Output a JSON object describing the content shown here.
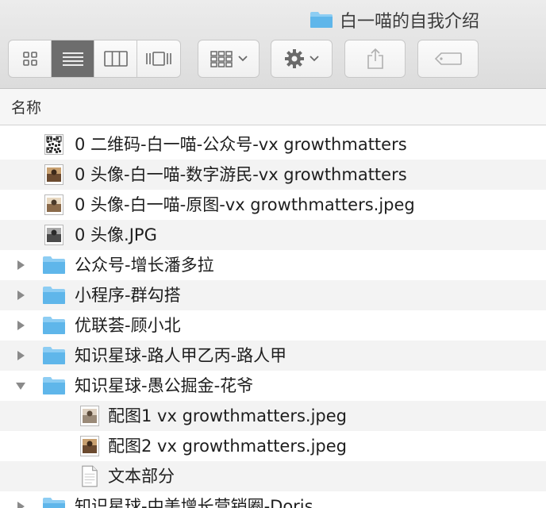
{
  "window": {
    "title": "白一喵的自我介绍"
  },
  "toolbar": {
    "view_buttons": [
      {
        "name": "icon-view",
        "active": false
      },
      {
        "name": "list-view",
        "active": true
      },
      {
        "name": "column-view",
        "active": false
      },
      {
        "name": "gallery-view",
        "active": false
      }
    ]
  },
  "column_header": {
    "name_label": "名称"
  },
  "files": [
    {
      "label": "0 二维码-白一喵-公众号-vx growthmatters",
      "kind": "qr-thumb",
      "level": 0,
      "expanded": null
    },
    {
      "label": "0 头像-白一喵-数字游民-vx growthmatters",
      "kind": "photo-thumb",
      "level": 0,
      "expanded": null
    },
    {
      "label": "0 头像-白一喵-原图-vx growthmatters.jpeg",
      "kind": "photo-thumb",
      "level": 0,
      "expanded": null
    },
    {
      "label": "0 头像.JPG",
      "kind": "photo-thumb",
      "level": 0,
      "expanded": null
    },
    {
      "label": "公众号-增长潘多拉",
      "kind": "folder",
      "level": 0,
      "expanded": false
    },
    {
      "label": "小程序-群勾搭",
      "kind": "folder",
      "level": 0,
      "expanded": false
    },
    {
      "label": "优联荟-顾小北",
      "kind": "folder",
      "level": 0,
      "expanded": false
    },
    {
      "label": "知识星球-路人甲乙丙-路人甲",
      "kind": "folder",
      "level": 0,
      "expanded": false
    },
    {
      "label": "知识星球-愚公掘金-花爷",
      "kind": "folder",
      "level": 0,
      "expanded": true
    },
    {
      "label": "配图1 vx growthmatters.jpeg",
      "kind": "photo-thumb",
      "level": 1,
      "expanded": null
    },
    {
      "label": "配图2 vx growthmatters.jpeg",
      "kind": "photo-thumb",
      "level": 1,
      "expanded": null
    },
    {
      "label": "文本部分",
      "kind": "document",
      "level": 1,
      "expanded": null
    },
    {
      "label": "知识星球-中美增长营销圈-Doris",
      "kind": "folder",
      "level": 0,
      "expanded": false
    }
  ],
  "colors": {
    "folder": "#5fb6ea",
    "folder_tab": "#8dcdf3",
    "active_view": "#6d6d6d",
    "alt_row": "#f3f3f3"
  }
}
